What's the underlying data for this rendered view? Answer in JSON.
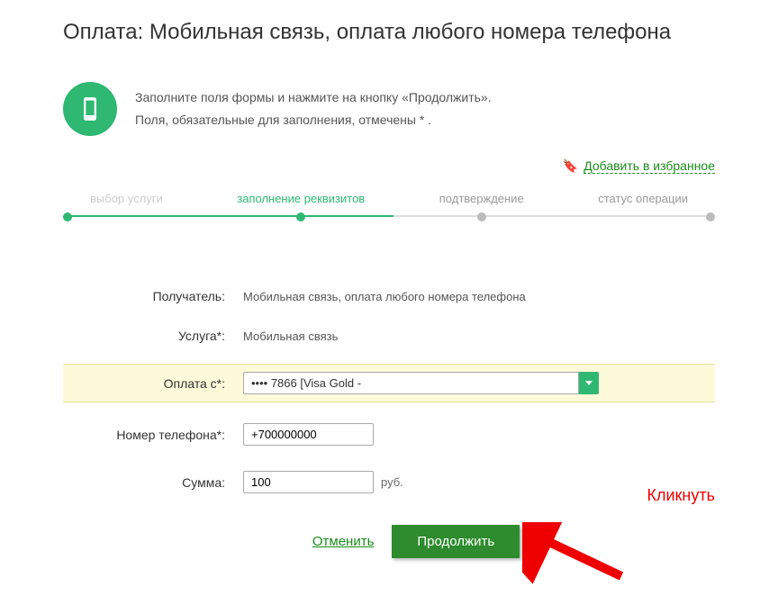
{
  "title": "Оплата: Мобильная связь, оплата любого номера телефона",
  "info": {
    "line1": "Заполните поля формы и нажмите на кнопку «Продолжить».",
    "line2": "Поля, обязательные для заполнения, отмечены * ."
  },
  "favorite_link": "Добавить в избранное",
  "steps": {
    "s1": "выбор услуги",
    "s2": "заполнение реквизитов",
    "s3": "подтверждение",
    "s4": "статус операции"
  },
  "form": {
    "recipient_label": "Получатель:",
    "recipient_value": "Мобильная связь, оплата любого номера телефона",
    "service_label": "Услуга*:",
    "service_value": "Мобильная связь",
    "payfrom_label": "Оплата с*:",
    "payfrom_value": "•••• 7866 [Visa Gold -",
    "phone_label": "Номер телефона*:",
    "phone_value": "+700000000",
    "amount_label": "Сумма:",
    "amount_value": "100",
    "amount_suffix": "руб."
  },
  "actions": {
    "cancel": "Отменить",
    "continue": "Продолжить"
  },
  "annotation": "Кликнуть"
}
